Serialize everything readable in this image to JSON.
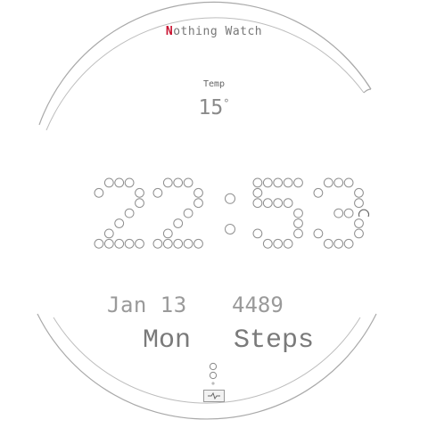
{
  "watch": {
    "brand_first": "N",
    "brand_rest": "othing Watch",
    "temp_label": "Temp",
    "temp_value": "15",
    "temp_unit": "°",
    "time": "22:53",
    "date": "Jan 13",
    "weekday": "Mon",
    "steps_count": "4489",
    "steps_label": "Steps",
    "icons": [
      "moon-icon",
      "complication-icon"
    ],
    "colors": {
      "brand_accent": "#c8102e",
      "dot_outline": "#999999",
      "ring": "#aaaaaa"
    }
  }
}
